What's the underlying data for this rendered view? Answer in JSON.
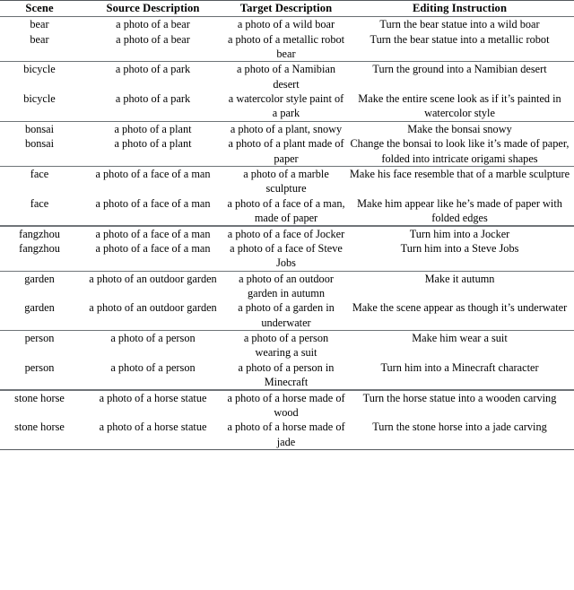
{
  "table": {
    "columns": [
      {
        "key": "scene",
        "label": "Scene"
      },
      {
        "key": "source",
        "label": "Source Description"
      },
      {
        "key": "target",
        "label": "Target Description"
      },
      {
        "key": "instruction",
        "label": "Editing Instruction"
      }
    ],
    "groups": [
      {
        "name": "bear",
        "rows": [
          {
            "scene": "bear",
            "source": "a photo of a bear",
            "target": "a photo of a wild boar",
            "instruction": "Turn the bear statue into a wild boar"
          },
          {
            "scene": "bear",
            "source": "a photo of a bear",
            "target": "a photo of a metallic robot bear",
            "instruction": "Turn the bear statue into a metallic robot"
          }
        ]
      },
      {
        "name": "bicycle",
        "rows": [
          {
            "scene": "bicycle",
            "source": "a photo of a park",
            "target": "a photo of a Namibian desert",
            "instruction": "Turn the ground into a Namibian desert"
          },
          {
            "scene": "bicycle",
            "source": "a photo of a park",
            "target": "a watercolor style paint of a park",
            "instruction": "Make the entire scene look as if it’s painted in watercolor style"
          }
        ]
      },
      {
        "name": "bonsai",
        "rows": [
          {
            "scene": "bonsai",
            "source": "a photo of a plant",
            "target": "a photo of a plant, snowy",
            "instruction": "Make the bonsai snowy"
          },
          {
            "scene": "bonsai",
            "source": "a photo of a plant",
            "target": "a photo of a plant made of paper",
            "instruction": "Change the bonsai to look like it’s made of paper, folded into intricate origami shapes"
          }
        ]
      },
      {
        "name": "face",
        "rows": [
          {
            "scene": "face",
            "source": "a photo of a face of a man",
            "target": "a photo of a marble sculpture",
            "instruction": "Make his face resemble that of a marble sculpture"
          },
          {
            "scene": "face",
            "source": "a photo of a face of a man",
            "target": "a photo of a face of a man, made of paper",
            "instruction": "Make him appear like he’s made of paper with folded edges"
          }
        ]
      },
      {
        "name": "fangzhou",
        "rows": [
          {
            "scene": "fangzhou",
            "source": "a photo of a face of a man",
            "target": "a photo of a face of Jocker",
            "instruction": "Turn him into a Jocker"
          },
          {
            "scene": "fangzhou",
            "source": "a photo of a face of a man",
            "target": "a photo of a face of Steve Jobs",
            "instruction": "Turn him into a Steve Jobs"
          }
        ]
      },
      {
        "name": "garden",
        "rows": [
          {
            "scene": "garden",
            "source": "a photo of an outdoor garden",
            "target": "a photo of an outdoor garden in autumn",
            "instruction": "Make it autumn"
          },
          {
            "scene": "garden",
            "source": "a photo of an outdoor garden",
            "target": "a photo of a garden in underwater",
            "instruction": "Make the scene appear as though it’s underwater"
          }
        ]
      },
      {
        "name": "person",
        "rows": [
          {
            "scene": "person",
            "source": "a photo of a person",
            "target": "a photo of a person wearing a suit",
            "instruction": "Make him wear a suit"
          },
          {
            "scene": "person",
            "source": "a photo of a person",
            "target": "a photo of a person in Minecraft",
            "instruction": "Turn him into a Minecraft character"
          }
        ]
      },
      {
        "name": "stone horse",
        "rows": [
          {
            "scene": "stone horse",
            "source": "a photo of a horse statue",
            "target": "a photo of a horse made of wood",
            "instruction": "Turn the horse statue into a wooden carving"
          },
          {
            "scene": "stone horse",
            "source": "a photo of a horse statue",
            "target": "a photo of a horse made of jade",
            "instruction": "Turn the stone horse into a jade carving"
          }
        ]
      }
    ]
  },
  "style": {
    "rule_color": "#5f6468",
    "text_color": "#000000",
    "background": "#ffffff"
  }
}
